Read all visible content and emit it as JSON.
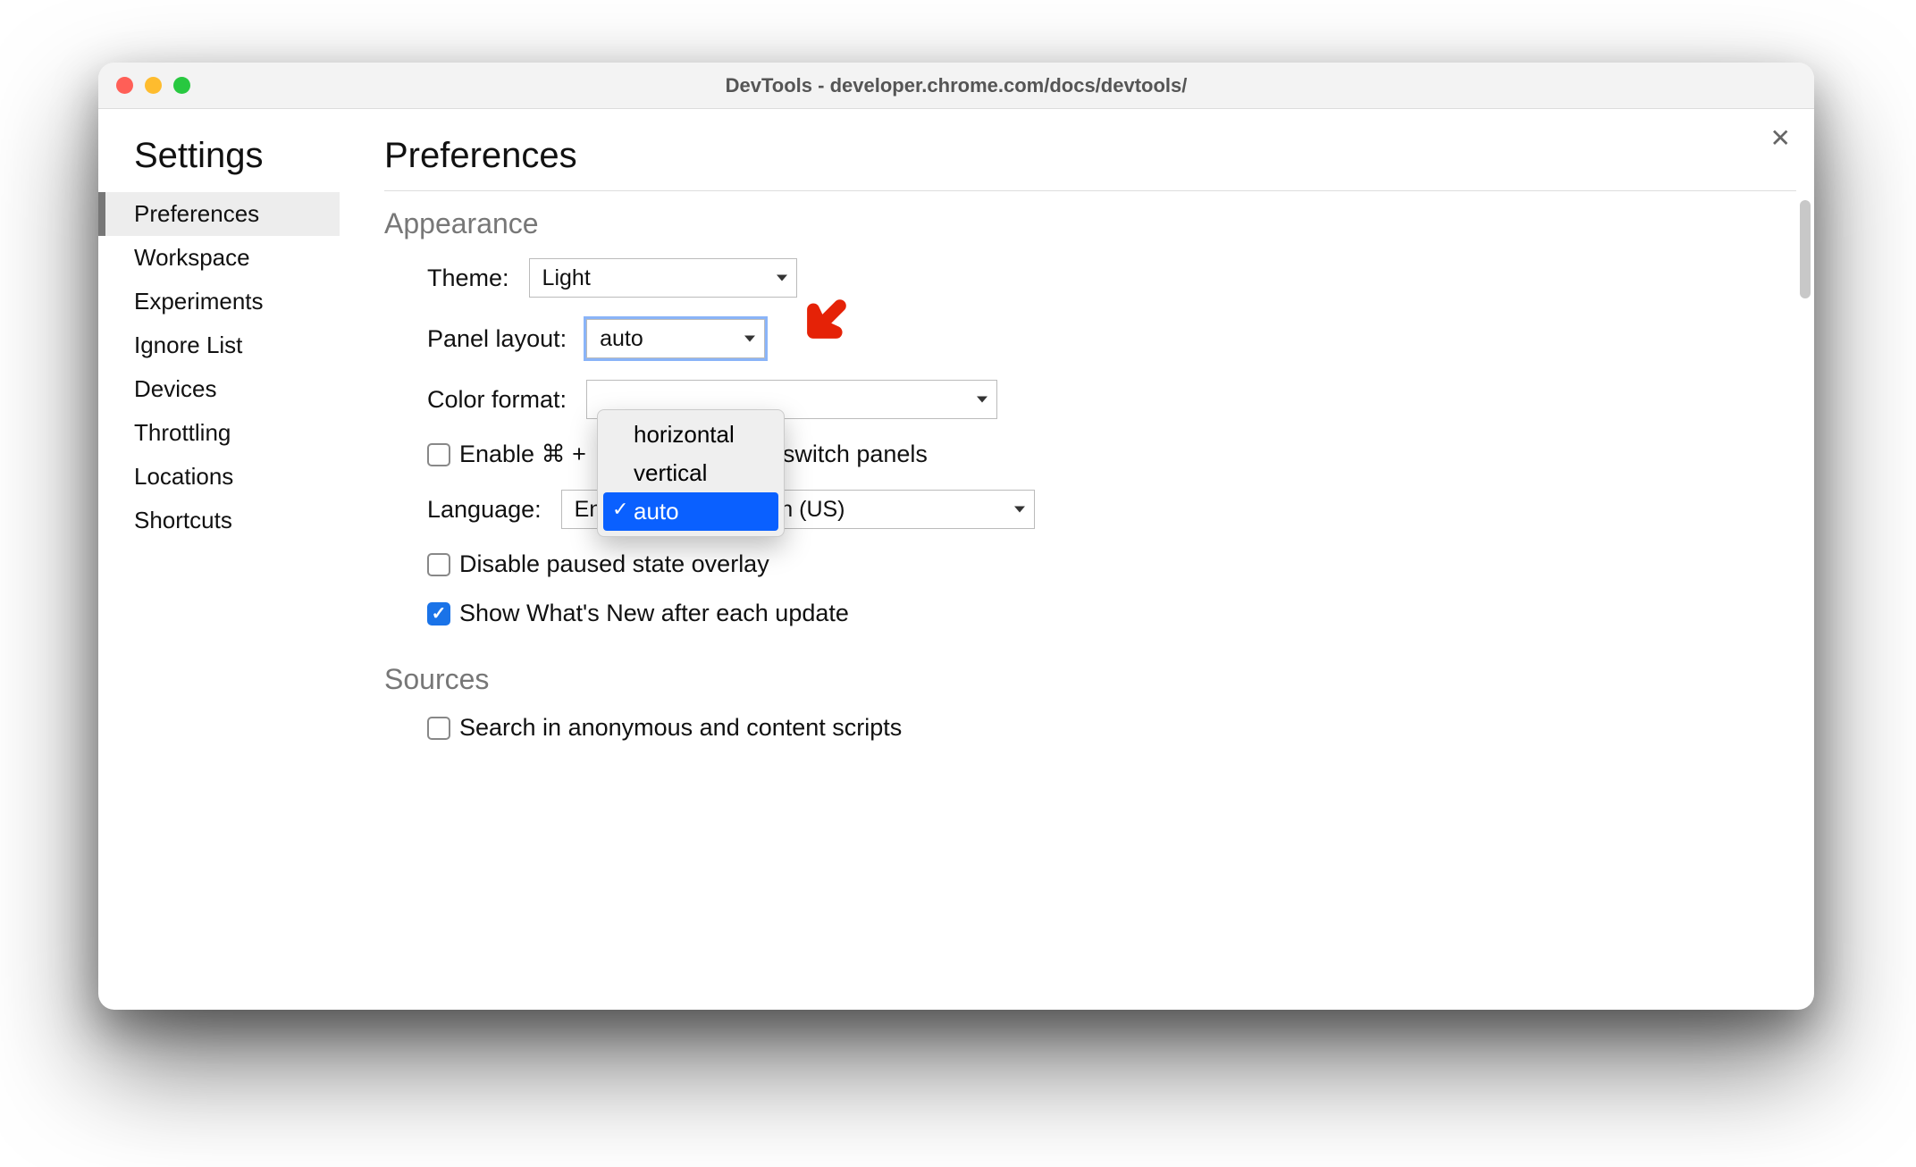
{
  "window": {
    "title": "DevTools - developer.chrome.com/docs/devtools/"
  },
  "sidebar": {
    "title": "Settings",
    "items": [
      {
        "label": "Preferences",
        "selected": true
      },
      {
        "label": "Workspace",
        "selected": false
      },
      {
        "label": "Experiments",
        "selected": false
      },
      {
        "label": "Ignore List",
        "selected": false
      },
      {
        "label": "Devices",
        "selected": false
      },
      {
        "label": "Throttling",
        "selected": false
      },
      {
        "label": "Locations",
        "selected": false
      },
      {
        "label": "Shortcuts",
        "selected": false
      }
    ]
  },
  "main": {
    "page_title": "Preferences",
    "sections": {
      "appearance": {
        "header": "Appearance",
        "theme": {
          "label": "Theme:",
          "value": "Light"
        },
        "panel_layout": {
          "label": "Panel layout:",
          "value": "auto",
          "options": [
            {
              "label": "horizontal",
              "selected": false
            },
            {
              "label": "vertical",
              "selected": false
            },
            {
              "label": "auto",
              "selected": true
            }
          ]
        },
        "color_format": {
          "label": "Color format:",
          "value": ""
        },
        "enable_cmd_switch": {
          "label_prefix": "Enable ⌘ + ",
          "label_suffix": " switch panels",
          "checked": false
        },
        "language": {
          "label": "Language:",
          "value": "English (US) - English (US)"
        },
        "disable_paused": {
          "label": "Disable paused state overlay",
          "checked": false
        },
        "show_whats_new": {
          "label": "Show What's New after each update",
          "checked": true
        }
      },
      "sources": {
        "header": "Sources",
        "search_anon": {
          "label": "Search in anonymous and content scripts",
          "checked": false
        }
      }
    }
  },
  "annotation": {
    "arrow_color": "#e52207"
  }
}
